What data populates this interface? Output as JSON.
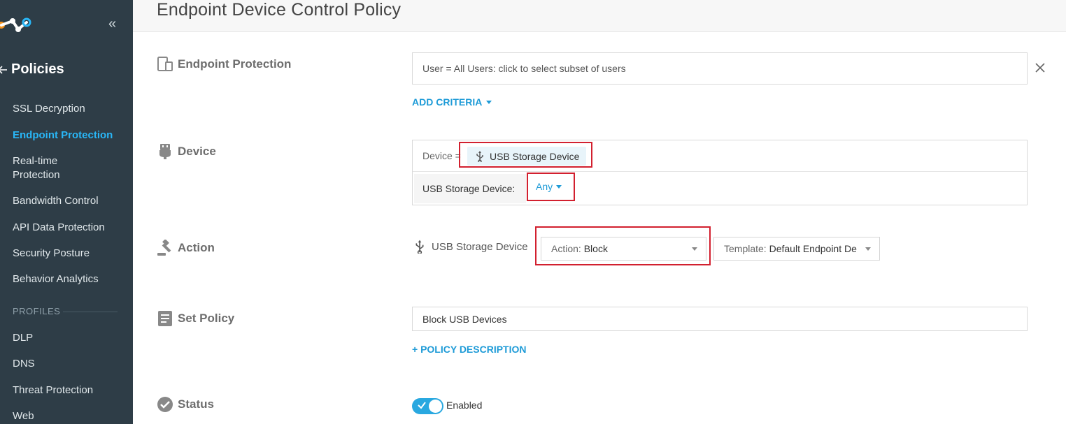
{
  "sidebar": {
    "title": "Policies",
    "collapse_glyph": "«",
    "items": [
      {
        "label": "SSL Decryption",
        "active": false
      },
      {
        "label": "Endpoint Protection",
        "active": true
      },
      {
        "label": "Real-time Protection",
        "active": false
      },
      {
        "label": "Bandwidth Control",
        "active": false
      },
      {
        "label": "API Data Protection",
        "active": false
      },
      {
        "label": "Security Posture",
        "active": false
      },
      {
        "label": "Behavior Analytics",
        "active": false
      }
    ],
    "profiles_label": "PROFILES",
    "profile_items": [
      {
        "label": "DLP"
      },
      {
        "label": "DNS"
      },
      {
        "label": "Threat Protection"
      },
      {
        "label": "Web"
      }
    ]
  },
  "header": {
    "title": "Endpoint Device Control Policy"
  },
  "sections": {
    "endpoint": {
      "label": "Endpoint Protection",
      "criteria_text": "User = All Users: click to select subset of users",
      "add_criteria_label": "ADD CRITERIA"
    },
    "device": {
      "label": "Device",
      "device_prefix": "Device =",
      "chip_label": "USB Storage Device",
      "row2_label": "USB Storage Device:",
      "any_label": "Any"
    },
    "action": {
      "label": "Action",
      "device_label": "USB Storage Device",
      "action_prefix": "Action:",
      "action_value": "Block",
      "template_prefix": "Template:",
      "template_value": "Default Endpoint De"
    },
    "set_policy": {
      "label": "Set Policy",
      "policy_name": "Block USB Devices",
      "add_description_label": "+ POLICY DESCRIPTION"
    },
    "status": {
      "label": "Status",
      "toggle_label": "Enabled",
      "enabled": true
    }
  },
  "colors": {
    "sidebar_bg": "#2e3d47",
    "accent_blue": "#1e9bd7",
    "active_nav": "#29b6f6",
    "highlight_red": "#d2202f",
    "toggle_on": "#29a8e0"
  }
}
